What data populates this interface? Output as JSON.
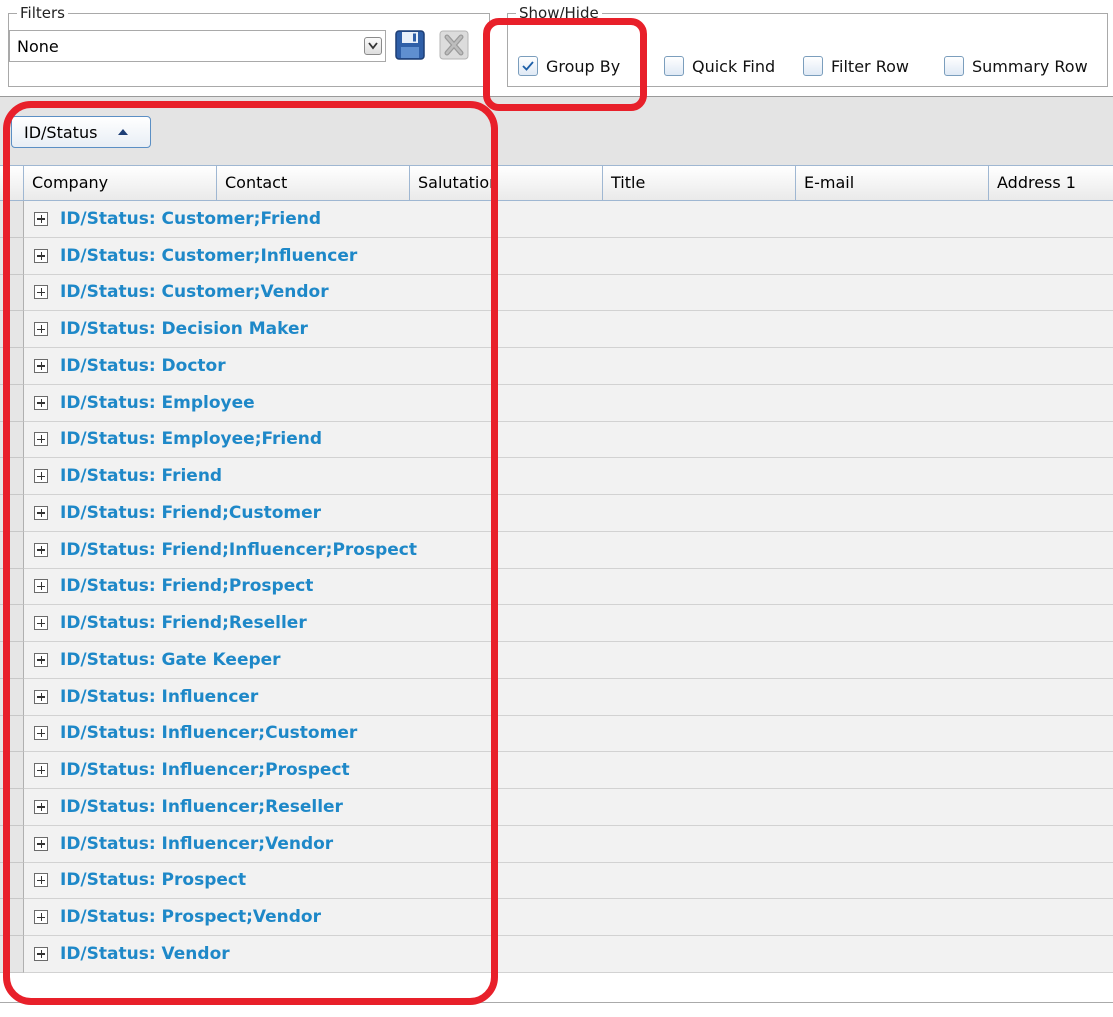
{
  "filters": {
    "legend": "Filters",
    "selected": "None"
  },
  "show_hide": {
    "legend": "Show/Hide",
    "options": [
      {
        "label": "Group By",
        "checked": true
      },
      {
        "label": "Quick Find",
        "checked": false
      },
      {
        "label": "Filter Row",
        "checked": false
      },
      {
        "label": "Summary Row",
        "checked": false
      }
    ]
  },
  "group_by": {
    "chip_label": "ID/Status",
    "sort": "ascending"
  },
  "columns": [
    "Company",
    "Contact",
    "Salutation",
    "Title",
    "E-mail",
    "Address 1"
  ],
  "groups": [
    "ID/Status: Customer;Friend",
    "ID/Status: Customer;Influencer",
    "ID/Status: Customer;Vendor",
    "ID/Status: Decision Maker",
    "ID/Status: Doctor",
    "ID/Status: Employee",
    "ID/Status: Employee;Friend",
    "ID/Status: Friend",
    "ID/Status: Friend;Customer",
    "ID/Status: Friend;Influencer;Prospect",
    "ID/Status: Friend;Prospect",
    "ID/Status: Friend;Reseller",
    "ID/Status: Gate Keeper",
    "ID/Status: Influencer",
    "ID/Status: Influencer;Customer",
    "ID/Status: Influencer;Prospect",
    "ID/Status: Influencer;Reseller",
    "ID/Status: Influencer;Vendor",
    "ID/Status: Prospect",
    "ID/Status: Prospect;Vendor",
    "ID/Status: Vendor"
  ],
  "colors": {
    "group_text": "#1e88c8",
    "annotation": "#e8202a"
  }
}
